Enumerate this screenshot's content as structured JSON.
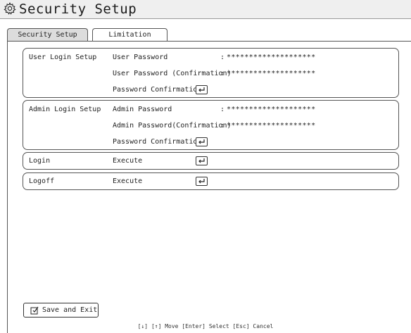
{
  "title": "Security Setup",
  "tabs": [
    {
      "label": "Security Setup",
      "active": true
    },
    {
      "label": "Limitation",
      "active": false
    }
  ],
  "user_login": {
    "label": "User Login Setup",
    "password_label": "User Password",
    "password_value": "********************",
    "confirm_label": "User Password (Confirmation)",
    "confirm_value": "********************",
    "password_confirmation_label": "Password Confirmation"
  },
  "admin_login": {
    "label": "Admin Login Setup",
    "password_label": "Admin Password",
    "password_value": "********************",
    "confirm_label": "Admin Password(Confirmation)",
    "confirm_value": "********************",
    "password_confirmation_label": "Password Confirmation"
  },
  "login": {
    "label": "Login",
    "action_label": "Execute"
  },
  "logoff": {
    "label": "Logoff",
    "action_label": "Execute"
  },
  "colon": ":",
  "save_exit_label": "Save and Exit",
  "hint": "[↓] [↑] Move  [Enter] Select  [Esc] Cancel",
  "icons": {
    "title": "gear-icon",
    "enter": "enter-key-icon",
    "save": "checkbox-pencil-icon"
  }
}
